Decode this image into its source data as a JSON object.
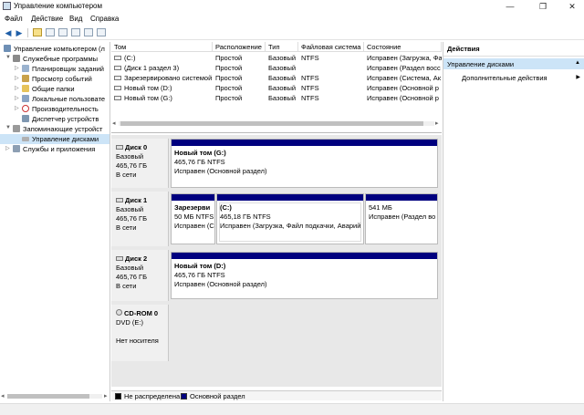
{
  "window": {
    "title": "Управление компьютером",
    "controls": [
      "—",
      "❐",
      "✕"
    ]
  },
  "menu": [
    "Файл",
    "Действие",
    "Вид",
    "Справка"
  ],
  "tree": {
    "root": "Управление компьютером (л",
    "items": [
      {
        "label": "Служебные программы",
        "level": 1,
        "expanded": true
      },
      {
        "label": "Планировщик заданий",
        "level": 2
      },
      {
        "label": "Просмотр событий",
        "level": 2
      },
      {
        "label": "Общие папки",
        "level": 2
      },
      {
        "label": "Локальные пользовате",
        "level": 2
      },
      {
        "label": "Производительность",
        "level": 2
      },
      {
        "label": "Диспетчер устройств",
        "level": 2
      },
      {
        "label": "Запоминающие устройст",
        "level": 1,
        "expanded": true
      },
      {
        "label": "Управление дисками",
        "level": 2,
        "selected": true
      },
      {
        "label": "Службы и приложения",
        "level": 1
      }
    ]
  },
  "volumes": {
    "columns": [
      "Том",
      "Расположение",
      "Тип",
      "Файловая система",
      "Состояние"
    ],
    "rows": [
      [
        "(C:)",
        "Простой",
        "Базовый",
        "NTFS",
        "Исправен (Загрузка, Файл"
      ],
      [
        "(Диск 1 раздел 3)",
        "Простой",
        "Базовый",
        "",
        "Исправен (Раздел восс"
      ],
      [
        "Зарезервировано системой",
        "Простой",
        "Базовый",
        "NTFS",
        "Исправен (Система, Ак"
      ],
      [
        "Новый том (D:)",
        "Простой",
        "Базовый",
        "NTFS",
        "Исправен (Основной р"
      ],
      [
        "Новый том (G:)",
        "Простой",
        "Базовый",
        "NTFS",
        "Исправен (Основной р"
      ]
    ]
  },
  "disks": [
    {
      "name": "Диск 0",
      "type": "Базовый",
      "size": "465,76 ГБ",
      "status": "В сети",
      "partitions": [
        {
          "title": "Новый том  (G:)",
          "line2": "465,76 ГБ NTFS",
          "line3": "Исправен (Основной раздел)"
        }
      ]
    },
    {
      "name": "Диск 1",
      "type": "Базовый",
      "size": "465,76 ГБ",
      "status": "В сети",
      "partitions": [
        {
          "title": "Зарезерви",
          "line2": "50 МБ NTFS",
          "line3": "Исправен (С"
        },
        {
          "title": "(C:)",
          "line2": "465,18 ГБ NTFS",
          "line3": "Исправен (Загрузка, Файл подкачки, Аварий"
        },
        {
          "title": "",
          "line2": "541 МБ",
          "line3": "Исправен (Раздел во"
        }
      ]
    },
    {
      "name": "Диск 2",
      "type": "Базовый",
      "size": "465,76 ГБ",
      "status": "В сети",
      "partitions": [
        {
          "title": "Новый том  (D:)",
          "line2": "465,76 ГБ NTFS",
          "line3": "Исправен (Основной раздел)"
        }
      ]
    },
    {
      "name": "CD-ROM 0",
      "type": "DVD (E:)",
      "size": "",
      "status": "Нет носителя",
      "partitions": []
    }
  ],
  "legend": [
    {
      "label": "Не распределена",
      "color": "#000000"
    },
    {
      "label": "Основной раздел",
      "color": "#00007f"
    }
  ],
  "actions": {
    "header": "Действия",
    "selected": "Управление дисками",
    "sub": "Дополнительные действия"
  }
}
